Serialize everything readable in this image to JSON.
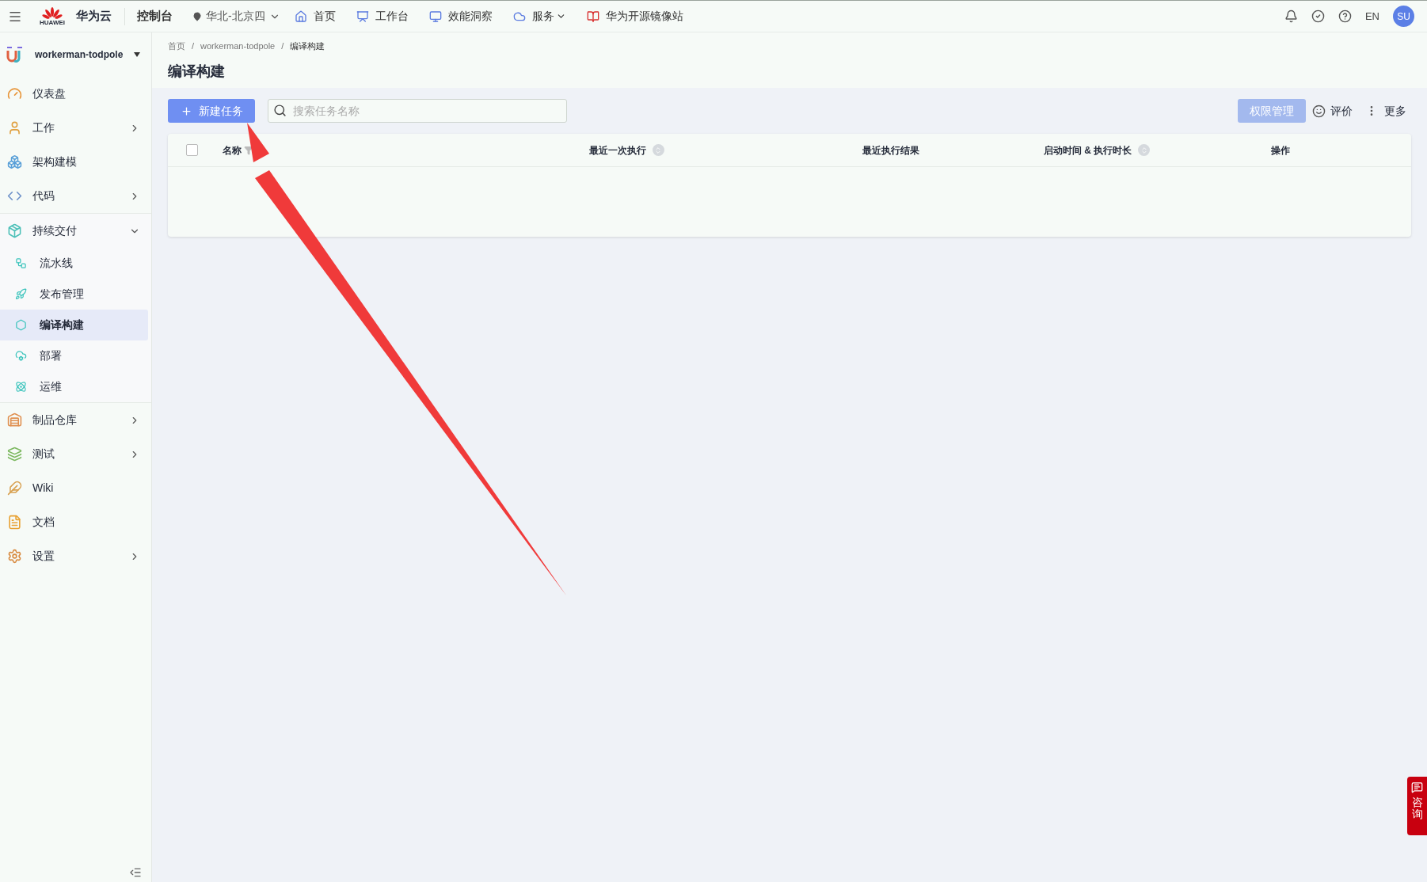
{
  "topbar": {
    "logo_text": "HUAWEI",
    "brand": "华为云",
    "console": "控制台",
    "region": "华北-北京四",
    "nav": [
      {
        "label": "首页",
        "kind": "home",
        "dropdown": false
      },
      {
        "label": "工作台",
        "kind": "desk",
        "dropdown": false
      },
      {
        "label": "效能洞察",
        "kind": "monitor",
        "dropdown": false
      },
      {
        "label": "服务",
        "kind": "cloud",
        "dropdown": true
      },
      {
        "label": "华为开源镜像站",
        "kind": "mirror",
        "dropdown": false
      }
    ],
    "language": "EN",
    "avatar": "SU"
  },
  "sidebar": {
    "project": "workerman-todpole",
    "items": [
      {
        "label": "仪表盘",
        "kind": "link",
        "selected": false
      },
      {
        "label": "工作",
        "kind": "group",
        "expanded": false,
        "selected": false
      },
      {
        "label": "架构建模",
        "kind": "link",
        "selected": false
      },
      {
        "label": "代码",
        "kind": "group",
        "expanded": false,
        "selected": false
      },
      {
        "label": "持续交付",
        "kind": "group",
        "expanded": true,
        "selected": false,
        "children": [
          {
            "label": "流水线",
            "selected": false
          },
          {
            "label": "发布管理",
            "selected": false
          },
          {
            "label": "编译构建",
            "selected": true
          },
          {
            "label": "部署",
            "selected": false
          },
          {
            "label": "运维",
            "selected": false
          }
        ]
      },
      {
        "label": "制品仓库",
        "kind": "group",
        "expanded": false,
        "selected": false
      },
      {
        "label": "测试",
        "kind": "group",
        "expanded": false,
        "selected": false
      },
      {
        "label": "Wiki",
        "kind": "link",
        "selected": false
      },
      {
        "label": "文档",
        "kind": "link",
        "selected": false
      },
      {
        "label": "设置",
        "kind": "group",
        "expanded": false,
        "selected": false
      }
    ]
  },
  "breadcrumb": [
    {
      "kind": "link",
      "text": "首页"
    },
    {
      "kind": "separator",
      "text": "/"
    },
    {
      "kind": "link",
      "text": "workerman-todpole"
    },
    {
      "kind": "separator",
      "text": "/"
    },
    {
      "kind": "current",
      "text": "编译构建"
    }
  ],
  "page_title": "编译构建",
  "toolbar": {
    "new_button": "新建任务",
    "search": {
      "placeholder": "搜索任务名称"
    },
    "permission_button": {
      "label": "权限管理",
      "disabled": true
    },
    "rate": "评价",
    "more": "更多"
  },
  "table": {
    "select_all": {
      "checked": false
    },
    "columns": [
      {
        "label": "名称",
        "kind": "filter"
      },
      {
        "label": "最近一次执行",
        "kind": "sort"
      },
      {
        "label": "最近执行结果",
        "kind": "plain"
      },
      {
        "label": "启动时间 & 执行时长",
        "kind": "sort"
      },
      {
        "label": "操作",
        "kind": "plain"
      }
    ]
  },
  "consult_button": "咨询"
}
